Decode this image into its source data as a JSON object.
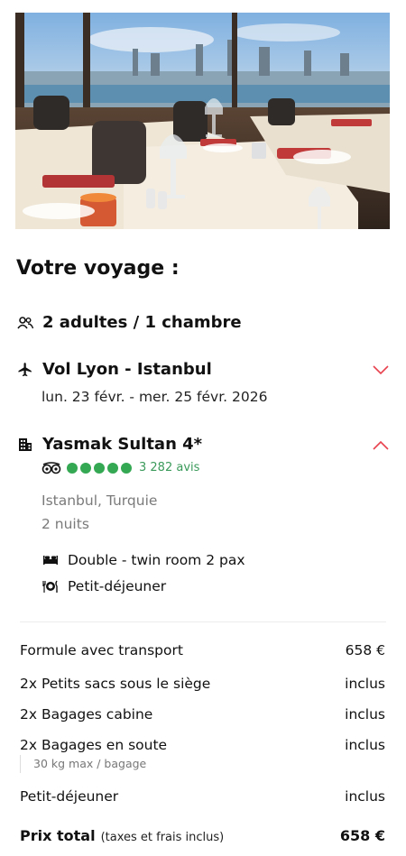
{
  "trip": {
    "title": "Votre voyage :",
    "travellers": "2 adultes / 1 chambre",
    "flight": {
      "label": "Vol Lyon - Istanbul",
      "dates": "lun. 23 févr. - mer. 25 févr. 2026",
      "expanded": false
    },
    "hotel": {
      "name": "Yasmak Sultan 4*",
      "rating_dots": 5,
      "reviews": "3 282 avis",
      "location": "Istanbul, Turquie",
      "nights": "2 nuits",
      "room": "Double - twin room 2 pax",
      "board": "Petit-déjeuner",
      "expanded": true
    }
  },
  "summary": {
    "rows": [
      {
        "label": "Formule avec transport",
        "value": "658 €"
      },
      {
        "label": "2x Petits sacs sous le siège",
        "value": "inclus"
      },
      {
        "label": "2x Bagages cabine",
        "value": "inclus"
      },
      {
        "label": "2x Bagages en soute",
        "value": "inclus",
        "note": "30 kg max / bagage"
      },
      {
        "label": "Petit-déjeuner",
        "value": "inclus"
      }
    ],
    "total_label": "Prix total",
    "total_note": "(taxes et frais inclus)",
    "total_value": "658 €"
  },
  "colors": {
    "accent": "#e8424f",
    "rating_green": "#34a853",
    "muted": "#7a7a7a"
  },
  "icons": {
    "travellers": "people-icon",
    "flight": "airplane-icon",
    "hotel": "building-icon",
    "room": "bed-icon",
    "board": "meal-icon",
    "rating": "tripadvisor-icon"
  }
}
